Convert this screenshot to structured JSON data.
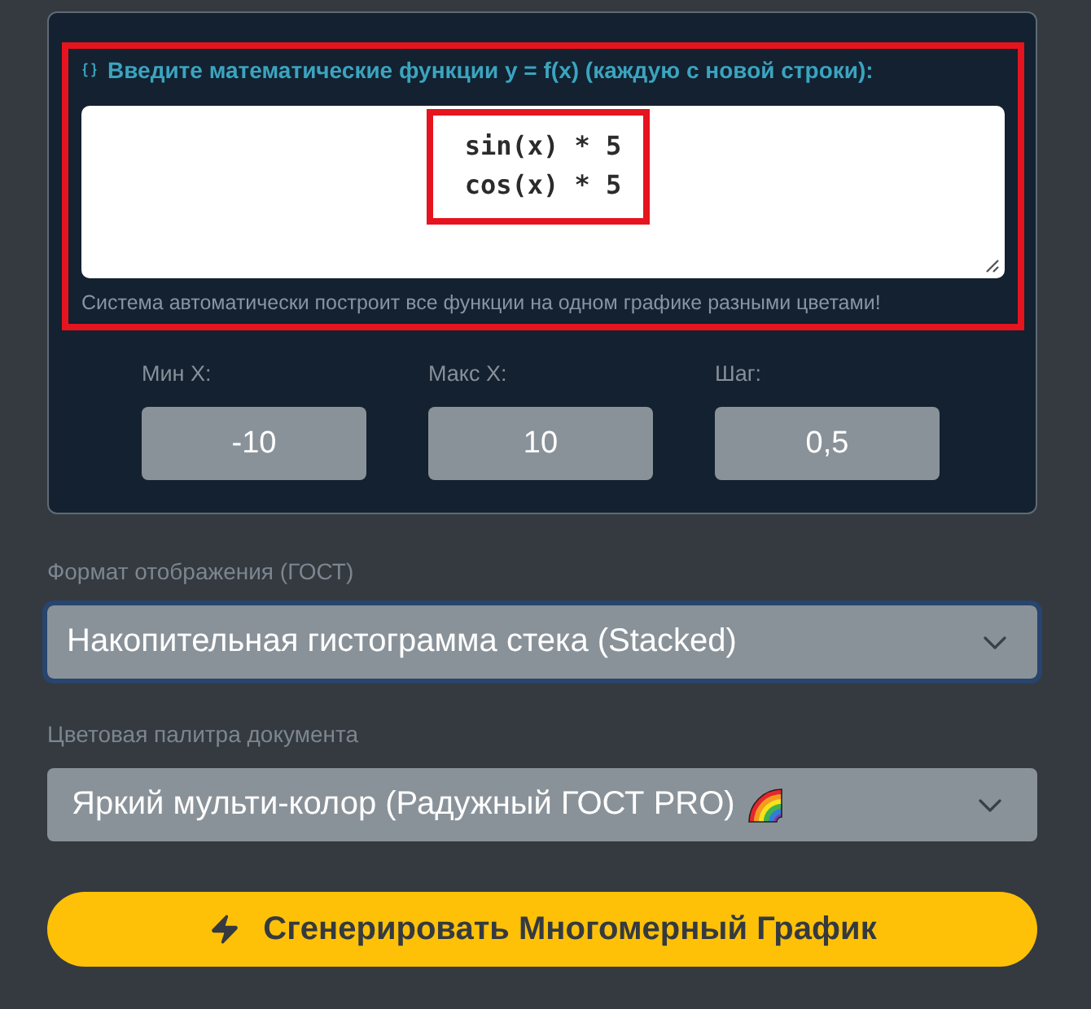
{
  "functions": {
    "highlighted": true,
    "label": "Введите математические функции y = f(x) (каждую с новой строки):",
    "lines_highlighted": true,
    "lines": [
      "sin(x) * 5",
      "cos(x) * 5"
    ],
    "hint": "Система автоматически построит все функции на одном графике разными цветами!"
  },
  "range_fields": [
    {
      "label": "Мин X:",
      "value": "-10"
    },
    {
      "label": "Макс X:",
      "value": "10"
    },
    {
      "label": "Шаг:",
      "value": "0,5"
    }
  ],
  "selects": [
    {
      "label": "Формат отображения (ГОСТ)",
      "value": "Накопительная гистограмма стека (Stacked)",
      "focused": true,
      "icon": false
    },
    {
      "label": "Цветовая палитра документа",
      "value": "Яркий мульти-колор (Радужный ГОСТ PRO)",
      "focused": false,
      "icon": true
    }
  ],
  "generate_button": {
    "label": "Сгенерировать Многомерный График"
  }
}
